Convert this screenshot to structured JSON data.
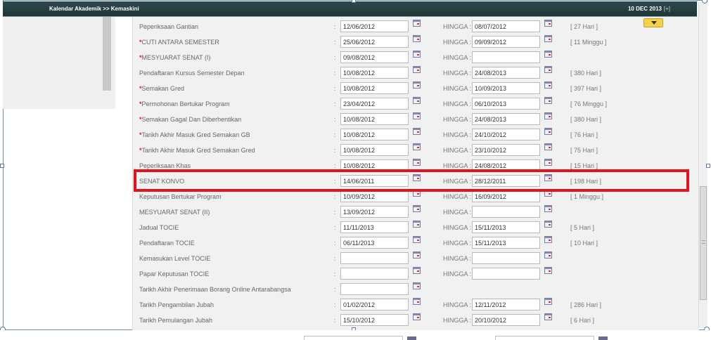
{
  "header": {
    "title": "Kalendar Akademik >> Kemaskini",
    "date": "10 DEC 2013",
    "expand": "[+]"
  },
  "labels": {
    "hingga": "HINGGA :",
    "colon": ":",
    "required_mark": "*"
  },
  "rows": [
    {
      "label": "Peperiksaan Gantian",
      "required": false,
      "from": "12/06/2012",
      "has_to": true,
      "to": "08/07/2012",
      "duration": "[ 27 Hari ]"
    },
    {
      "label": "CUTI ANTARA SEMESTER",
      "required": true,
      "from": "25/06/2012",
      "has_to": true,
      "to": "09/09/2012",
      "duration": "[ 11 Minggu ]"
    },
    {
      "label": "MESYUARAT SENAT (I)",
      "required": true,
      "from": "09/08/2012",
      "has_to": true,
      "to": "",
      "duration": ""
    },
    {
      "label": "Pendaftaran Kursus Semester Depan",
      "required": false,
      "from": "10/08/2012",
      "has_to": true,
      "to": "24/08/2013",
      "duration": "[ 380 Hari ]"
    },
    {
      "label": "Semakan Gred",
      "required": true,
      "from": "10/08/2012",
      "has_to": true,
      "to": "10/09/2013",
      "duration": "[ 397 Hari ]"
    },
    {
      "label": "Permohonan Bertukar Program",
      "required": true,
      "from": "23/04/2012",
      "has_to": true,
      "to": "06/10/2013",
      "duration": "[ 76 Minggu ]"
    },
    {
      "label": "Semakan Gagal Dan Diberhentikan",
      "required": true,
      "from": "10/08/2012",
      "has_to": true,
      "to": "24/08/2013",
      "duration": "[ 380 Hari ]"
    },
    {
      "label": "Tarikh Akhir Masuk Gred Semakan GB",
      "required": true,
      "from": "10/08/2012",
      "has_to": true,
      "to": "24/10/2012",
      "duration": "[ 76 Hari ]"
    },
    {
      "label": "Tarikh Akhir Masuk Gred Semakan Gred",
      "required": true,
      "from": "10/08/2012",
      "has_to": true,
      "to": "23/10/2012",
      "duration": "[ 75 Hari ]"
    },
    {
      "label": "Peperiksaan Khas",
      "required": false,
      "from": "10/08/2012",
      "has_to": true,
      "to": "24/08/2012",
      "duration": "[ 15 Hari ]"
    },
    {
      "label": "SENAT KONVO",
      "required": false,
      "from": "14/06/2011",
      "has_to": true,
      "to": "28/12/2011",
      "duration": "[ 198 Hari ]"
    },
    {
      "label": "Keputusan Bertukar Program",
      "required": false,
      "from": "10/09/2012",
      "has_to": true,
      "to": "16/09/2012",
      "duration": "[ 1 Minggu ]"
    },
    {
      "label": "MESYUARAT SENAT (II)",
      "required": false,
      "from": "13/09/2012",
      "has_to": true,
      "to": "",
      "duration": ""
    },
    {
      "label": "Jadual TOCIE",
      "required": false,
      "from": "11/11/2013",
      "has_to": true,
      "to": "15/11/2013",
      "duration": "[ 5 Hari ]"
    },
    {
      "label": "Pendaftaran TOCIE",
      "required": false,
      "from": "06/11/2013",
      "has_to": true,
      "to": "15/11/2013",
      "duration": "[ 10 Hari ]"
    },
    {
      "label": "Kemasukan Level TOCIE",
      "required": false,
      "from": "",
      "has_to": true,
      "to": "",
      "duration": ""
    },
    {
      "label": "Papar Keputusan TOCIE",
      "required": false,
      "from": "",
      "has_to": true,
      "to": "",
      "duration": ""
    },
    {
      "label": "Tarikh Akhir Penerimaan Borang Online Antarabangsa",
      "required": false,
      "from": "",
      "has_to": false,
      "to": "",
      "duration": ""
    },
    {
      "label": "Tarikh Pengambilan Jubah",
      "required": false,
      "from": "01/02/2012",
      "has_to": true,
      "to": "12/11/2012",
      "duration": "[ 286 Hari ]"
    },
    {
      "label": "Tarikh Pemulangan Jubah",
      "required": false,
      "from": "15/10/2012",
      "has_to": true,
      "to": "20/10/2012",
      "duration": "[ 6 Hari ]"
    }
  ],
  "colors": {
    "header_bg": "#2f4b4e",
    "highlight_border": "#e4121b",
    "required_mark": "#e02020",
    "dropdown_button": "#f4d24a"
  }
}
